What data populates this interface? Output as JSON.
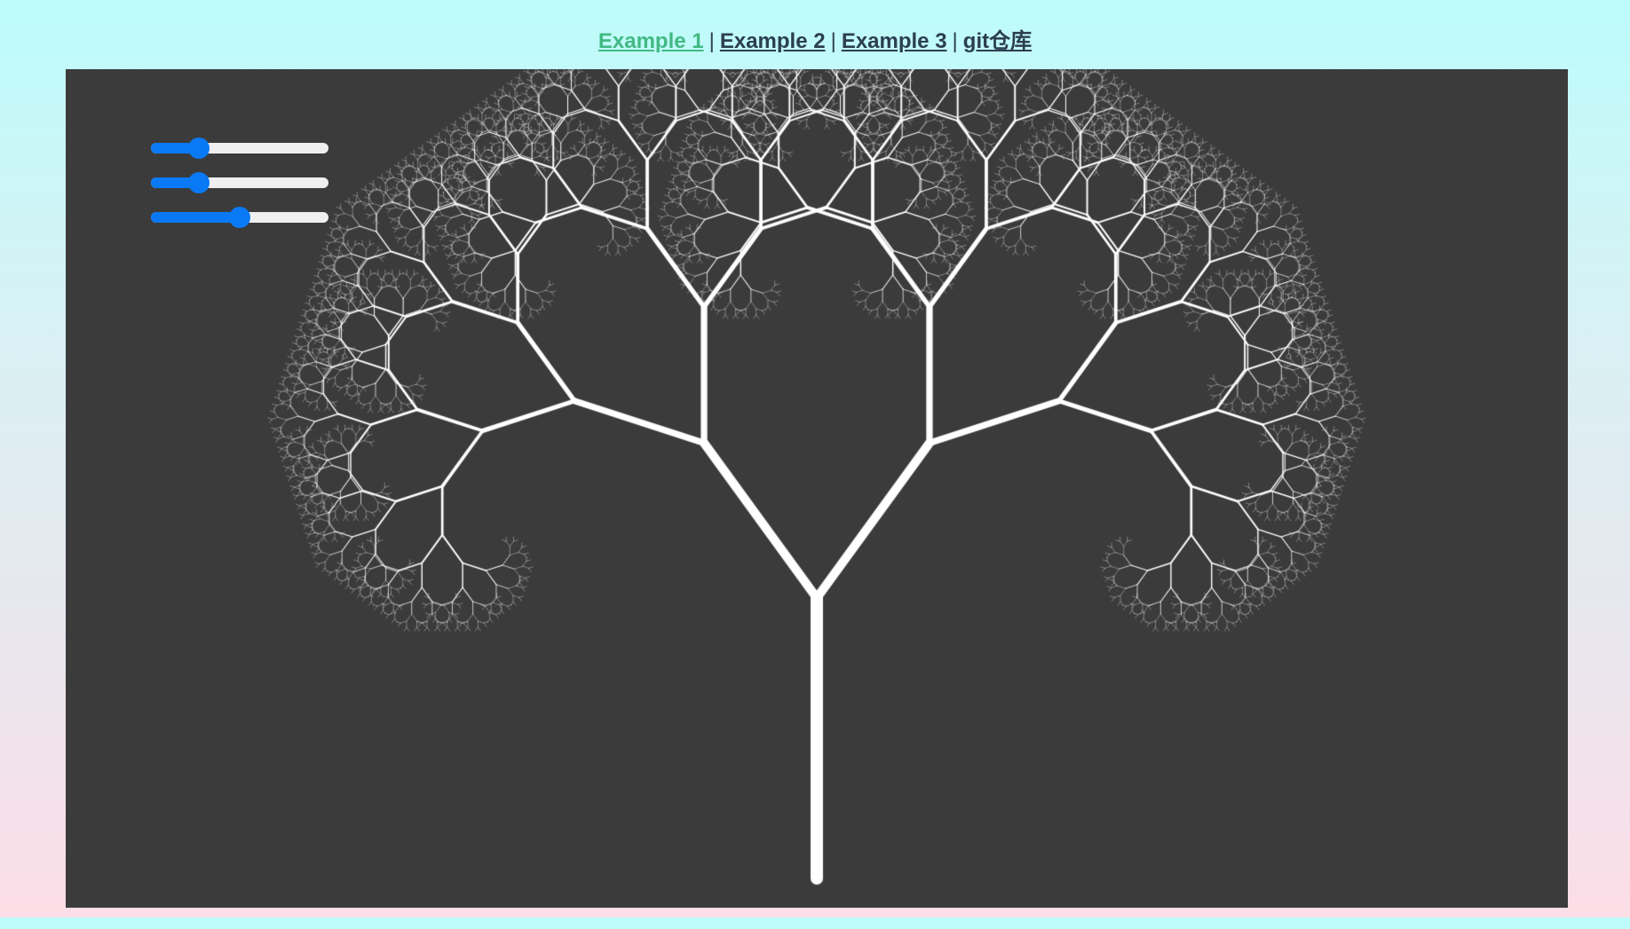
{
  "nav": {
    "links": [
      {
        "label": "Example 1",
        "active": true
      },
      {
        "label": "Example 2",
        "active": false
      },
      {
        "label": "Example 3",
        "active": false
      },
      {
        "label": "git仓库",
        "active": false
      }
    ],
    "separator": "|"
  },
  "sliders": [
    {
      "value": 0.24
    },
    {
      "value": 0.24
    },
    {
      "value": 0.5
    }
  ],
  "colors": {
    "accent": "#42b983",
    "link": "#2c3e50",
    "slider": "#0a79f5",
    "canvas_bg": "#3b3b3b",
    "tree": "#ffffff"
  },
  "tree": {
    "depth": 12,
    "branch_angle_deg": 36,
    "length_ratio": 0.71
  }
}
